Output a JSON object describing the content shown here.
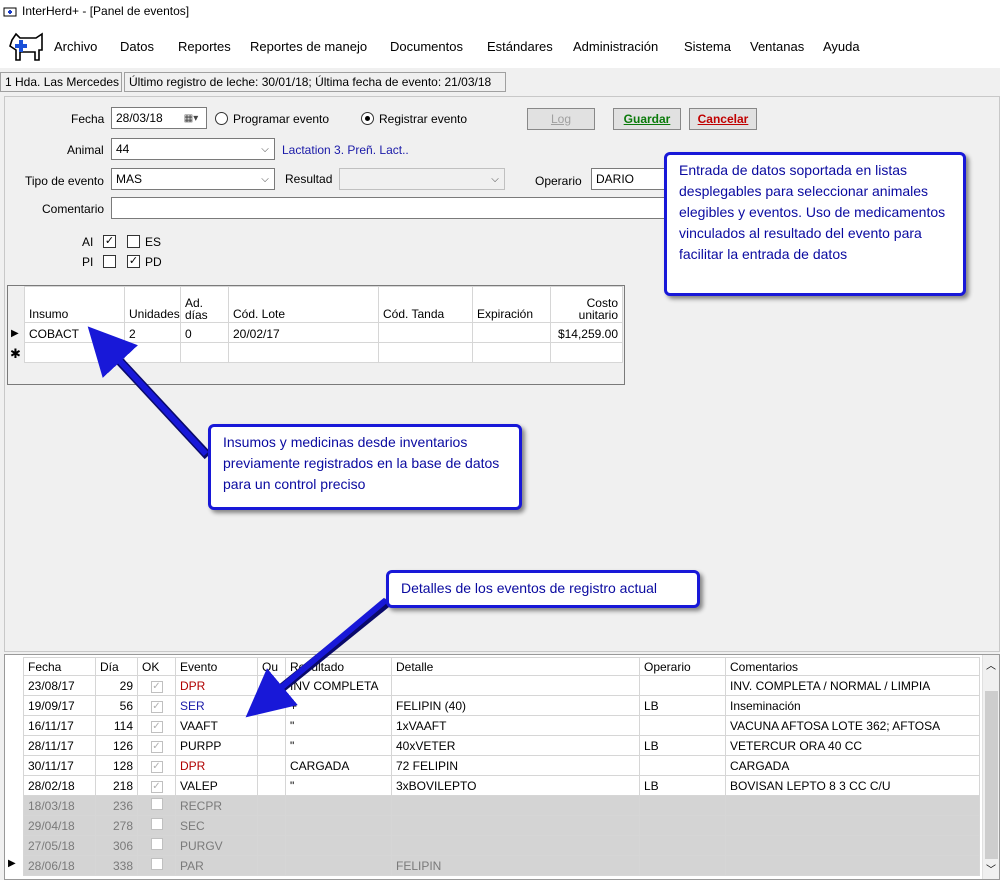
{
  "window": {
    "title": "InterHerd+ - [Panel de eventos]"
  },
  "menu": [
    "Archivo",
    "Datos",
    "Reportes",
    "Reportes de manejo",
    "Documentos",
    "Estándares",
    "Administración",
    "Sistema",
    "Ventanas",
    "Ayuda"
  ],
  "status": {
    "herd": "1 Hda. Las Mercedes",
    "info": "Último registro de leche: 30/01/18; Última fecha de evento: 21/03/18"
  },
  "form": {
    "fecha_label": "Fecha",
    "fecha_value": "28/03/18",
    "programar_label": "Programar evento",
    "registrar_label": "Registrar evento",
    "log_label": "Log",
    "guardar_label": "Guardar",
    "cancelar_label": "Cancelar",
    "animal_label": "Animal",
    "animal_value": "44",
    "animal_info": "Lactation 3. Preñ. Lact..",
    "tipo_label": "Tipo de evento",
    "tipo_value": "MAS",
    "resultado_label": "Resultad",
    "resultado_value": "",
    "operario_label": "Operario",
    "operario_value": "DARIO",
    "comentario_label": "Comentario",
    "comentario_value": "",
    "ai_label": "AI",
    "es_label": "ES",
    "pi_label": "PI",
    "pd_label": "PD",
    "ai_checked": true,
    "es_checked": false,
    "pi_checked": false,
    "pd_checked": true
  },
  "insumos": {
    "headers": [
      "Insumo",
      "Unidades",
      "Ad. días",
      "Cód. Lote",
      "Cód. Tanda",
      "Expiración",
      "Costo unitario"
    ],
    "rows": [
      [
        "COBACT",
        "2",
        "0",
        "20/02/17",
        "",
        "",
        "$14,259.00"
      ]
    ]
  },
  "callouts": {
    "top": "Entrada de datos soportada en listas desplegables para seleccionar animales elegibles y eventos. Uso de medicamentos vinculados al resultado del evento para facilitar la entrada de datos",
    "middle": "Insumos y medicinas desde inventarios previamente registrados en la base de datos para un control preciso",
    "bottom": "Detalles de los eventos de registro actual"
  },
  "events": {
    "headers": [
      "Fecha",
      "Día",
      "OK",
      "Evento",
      "Qu",
      "Resultado",
      "Detalle",
      "Operario",
      "Comentarios"
    ],
    "rows": [
      {
        "fecha": "23/08/17",
        "dia": "29",
        "ok": true,
        "evento": "DPR",
        "qu": "",
        "resultado": "INV COMPLETA",
        "detalle": "",
        "operario": "",
        "comentarios": "INV. COMPLETA / NORMAL / LIMPIA",
        "color": "#b00000",
        "future": false
      },
      {
        "fecha": "19/09/17",
        "dia": "56",
        "ok": true,
        "evento": "SER",
        "qu": "",
        "resultado": "+",
        "detalle": "FELIPIN (40)",
        "operario": "LB",
        "comentarios": "Inseminación",
        "color": "#1a1aa8",
        "future": false
      },
      {
        "fecha": "16/11/17",
        "dia": "114",
        "ok": true,
        "evento": "VAAFT",
        "qu": "",
        "resultado": "\"",
        "detalle": "1xVAAFT",
        "operario": "",
        "comentarios": "VACUNA AFTOSA LOTE 362; AFTOSA",
        "color": "#000000",
        "future": false
      },
      {
        "fecha": "28/11/17",
        "dia": "126",
        "ok": true,
        "evento": "PURPP",
        "qu": "",
        "resultado": "\"",
        "detalle": "40xVETER",
        "operario": "LB",
        "comentarios": "VETERCUR ORA 40 CC",
        "color": "#000000",
        "future": false
      },
      {
        "fecha": "30/11/17",
        "dia": "128",
        "ok": true,
        "evento": "DPR",
        "qu": "",
        "resultado": "CARGADA",
        "detalle": "72 FELIPIN",
        "operario": "",
        "comentarios": "CARGADA",
        "color": "#b00000",
        "future": false
      },
      {
        "fecha": "28/02/18",
        "dia": "218",
        "ok": true,
        "evento": "VALEP",
        "qu": "",
        "resultado": "\"",
        "detalle": "3xBOVILEPTO",
        "operario": "LB",
        "comentarios": "BOVISAN LEPTO 8 3 CC C/U",
        "color": "#000000",
        "future": false
      },
      {
        "fecha": "18/03/18",
        "dia": "236",
        "ok": false,
        "evento": "RECPR",
        "qu": "",
        "resultado": "",
        "detalle": "",
        "operario": "",
        "comentarios": "",
        "color": "#7a7a7a",
        "future": true
      },
      {
        "fecha": "29/04/18",
        "dia": "278",
        "ok": false,
        "evento": "SEC",
        "qu": "",
        "resultado": "",
        "detalle": "",
        "operario": "",
        "comentarios": "",
        "color": "#7a7a7a",
        "future": true
      },
      {
        "fecha": "27/05/18",
        "dia": "306",
        "ok": false,
        "evento": "PURGV",
        "qu": "",
        "resultado": "",
        "detalle": "",
        "operario": "",
        "comentarios": "",
        "color": "#7a7a7a",
        "future": true
      },
      {
        "fecha": "28/06/18",
        "dia": "338",
        "ok": false,
        "evento": "PAR",
        "qu": "",
        "resultado": "",
        "detalle": "FELIPIN",
        "operario": "",
        "comentarios": "",
        "color": "#7a7a7a",
        "future": true
      }
    ]
  }
}
